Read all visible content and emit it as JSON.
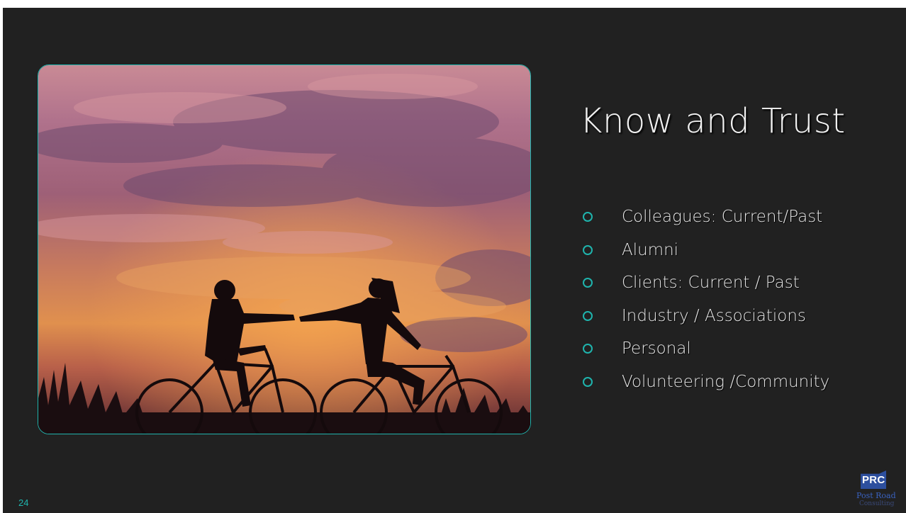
{
  "slide": {
    "title": "Know and Trust",
    "bullets": [
      "Colleagues: Current/Past",
      "Alumni",
      "Clients: Current / Past",
      "Industry / Associations",
      "Personal",
      "Volunteering /Community"
    ],
    "slide_number": "24",
    "logo": {
      "badge_text": "PRC",
      "line1": "Post Road",
      "line2": "Consulting"
    },
    "image": {
      "subject": "silhouette-couple-bicycles-sunset"
    }
  },
  "colors": {
    "background": "#212121",
    "accent": "#1fb4ad",
    "text": "#f2f2f2",
    "logo_blue": "#2d4f9e"
  }
}
